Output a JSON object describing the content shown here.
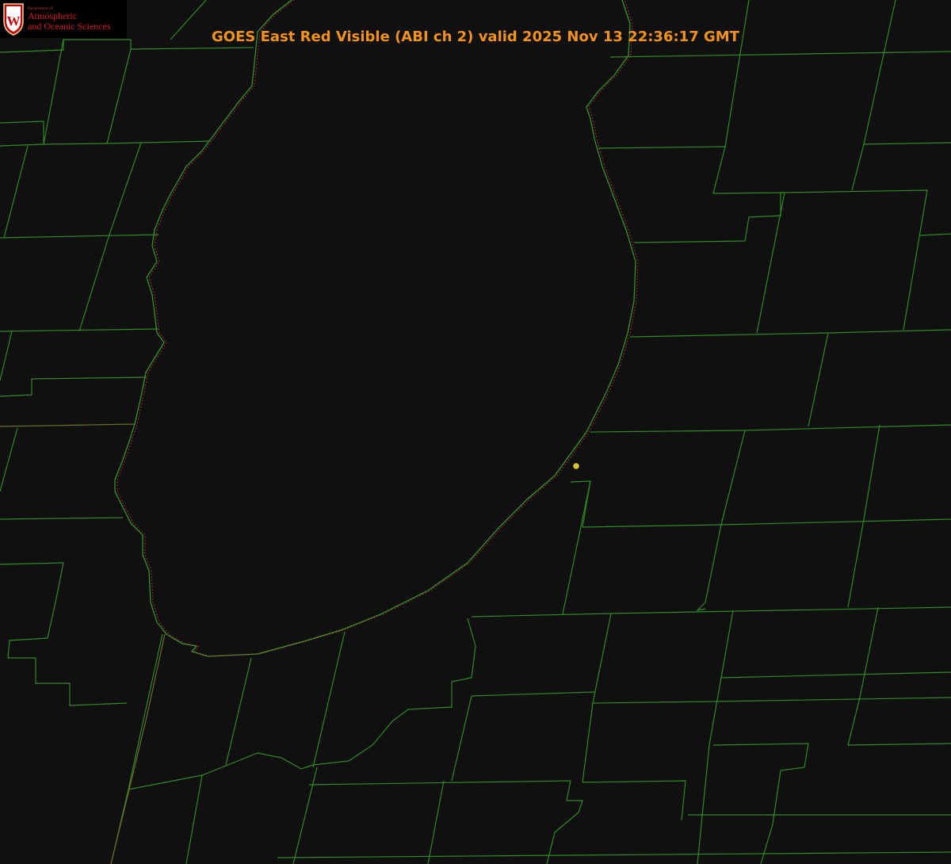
{
  "title": "GOES East Red Visible (ABI ch 2) valid 2025 Nov 13 22:36:17 GMT",
  "logo": {
    "dept": "Department of",
    "line1": "Atmospheric",
    "line2": "and Oceanic Sciences",
    "crest_letter": "W",
    "crest_icon": "uw-crest-icon"
  },
  "colors": {
    "background": "#101010",
    "county_lines": "#2f8a23",
    "shoreline": "#3a9a2a",
    "state_border": "#c0392b",
    "title": "#f3921c",
    "marker": "#d9c23a",
    "logo_red": "#c5050c"
  },
  "icons": {
    "station_marker": "yellow-dot-marker"
  }
}
